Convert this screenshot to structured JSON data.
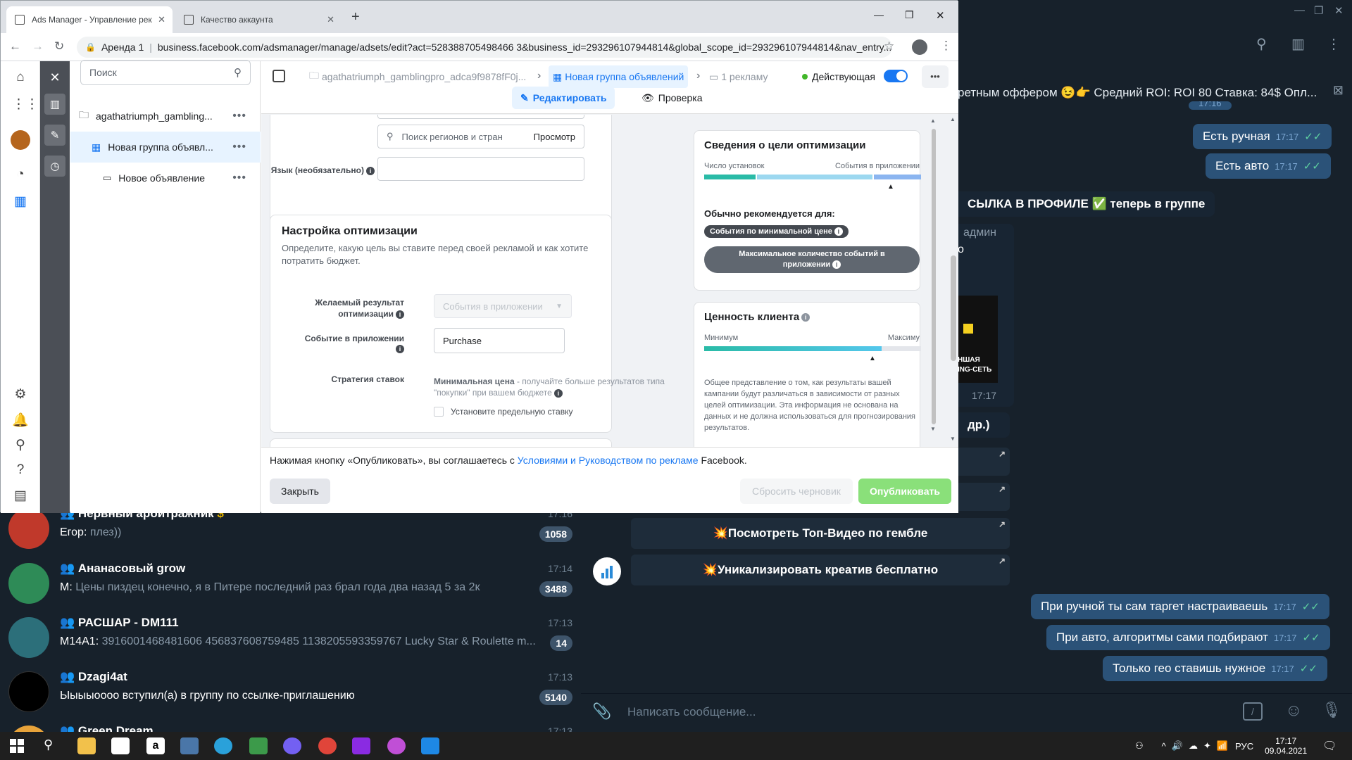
{
  "browser": {
    "tabs": [
      {
        "label": "Ads Manager - Управление рек",
        "active": true
      },
      {
        "label": "Качество аккаунта",
        "active": false
      }
    ],
    "new_tab": "+",
    "win_min": "—",
    "win_max": "❐",
    "win_close": "✕",
    "url_prefix": "Аренда 1",
    "url": "business.facebook.com/adsmanager/manage/adsets/edit?act=528388705498466 3&business_id=293296107944814&global_scope_id=293296107944814&nav_entry..."
  },
  "ads": {
    "search_placeholder": "Поиск",
    "tree": [
      {
        "label": "agathatriumph_gambling..."
      },
      {
        "label": "Новая группа объявл..."
      },
      {
        "label": "Новое объявление"
      }
    ],
    "more": "•••",
    "breadcrumb": {
      "campaign": "agathatriumph_gamblingpro_adca9f9878fF0j...",
      "adset": "Новая группа объявлений",
      "ads": "1 рекламу",
      "status": "Действующая"
    },
    "tabs": {
      "edit": "Редактировать",
      "review": "Проверка"
    },
    "region": {
      "placeholder": "Поиск регионов и стран",
      "browse": "Просмотр"
    },
    "language_label": "Язык (необязательно)",
    "optimization": {
      "title": "Настройка оптимизации",
      "desc": "Определите, какую цель вы ставите перед своей рекламой и как хотите потратить бюджет.",
      "goal_label": "Желаемый результат оптимизации",
      "goal_value": "События в приложении",
      "event_label": "Событие в приложении",
      "event_value": "Purchase",
      "strategy_label": "Стратегия ставок",
      "strategy_bold": "Минимальная цена",
      "strategy_text": " - получайте больше результатов типа \"покупки\" при вашем бюджете",
      "cap_checkbox": "Установите предельную ставку"
    },
    "side_goal": {
      "title": "Сведения о цели оптимизации",
      "left": "Число установок",
      "right": "События в приложении",
      "recommended": "Обычно рекомендуется для:",
      "pill1": "События по минимальной цене",
      "pill2": "Максимальное количество событий в приложении"
    },
    "side_value": {
      "title": "Ценность клиента",
      "min": "Минимум",
      "max": "Максиму",
      "desc": "Общее представление о том, как результаты вашей кампании будут различаться в зависимости от разных целей оптимизации. Эта информация не основана на данных и не должна использоваться для прогнозирования результатов."
    },
    "footer": {
      "notice_pre": "Нажимая кнопку «Опубликовать», вы соглашаетесь с ",
      "notice_link": "Условиями и Руководством по рекламе",
      "notice_post": " Facebook.",
      "close": "Закрыть",
      "reset": "Сбросить черновик",
      "publish": "Опубликовать"
    }
  },
  "telegram": {
    "pinned": "ретным оффером 😉👉  Средний ROI: ROI 80 Ставка: 84$ Опл...",
    "out_messages": [
      {
        "text": "Есть ручная",
        "time": "17:17"
      },
      {
        "text": "Есть авто",
        "time": "17:17"
      },
      {
        "text": "При ручной ты сам таргет настраиваешь",
        "time": "17:17"
      },
      {
        "text": "При авто, алгоритмы сами подбирают",
        "time": "17:17"
      },
      {
        "text": "Только гео ставишь нужное",
        "time": "17:17"
      }
    ],
    "partial_time": "17:16",
    "in_link": "СЫЛКА В ПРОФИЛЕ ✅ теперь в группе",
    "admin": "админ",
    "admin2": "о",
    "media_time": "17:17",
    "media_caption1": "НШАЯ",
    "media_caption2": "ING-СЕТЬ",
    "others": "др.)",
    "buttons": [
      {
        "text": "💥Посмотреть Топ-Видео по гембле"
      },
      {
        "text": "💥Уникализировать креатив бесплатно"
      }
    ],
    "composer_placeholder": "Написать сообщение...",
    "chats": [
      {
        "name": "Нервный арбитражник",
        "time": "17:16",
        "who": "Егор: ",
        "msg": "плез))",
        "badge": "1058"
      },
      {
        "name": "Ананасовый grow",
        "time": "17:14",
        "who": "М: ",
        "msg": "Цены пиздец конечно, я в Питере последний раз брал года два назад 5 за 2к",
        "badge": "3488"
      },
      {
        "name": "РАСШАР - DM111",
        "time": "17:13",
        "who": "M14A1: ",
        "msg": "3916001468481606 456837608759485 1138205593359767  Lucky Star  & Roulette m...",
        "badge": "14"
      },
      {
        "name": "Dzagi4at",
        "time": "17:13",
        "who": "",
        "msg": "Ыыыыоооо вступил(а) в группу по ссылке-приглашению",
        "badge": "5140"
      },
      {
        "name": "Green Dream",
        "time": "17:13",
        "who": "",
        "msg": "",
        "badge": ""
      }
    ]
  },
  "taskbar": {
    "lang": "РУС",
    "time": "17:17",
    "date": "09.04.2021"
  }
}
